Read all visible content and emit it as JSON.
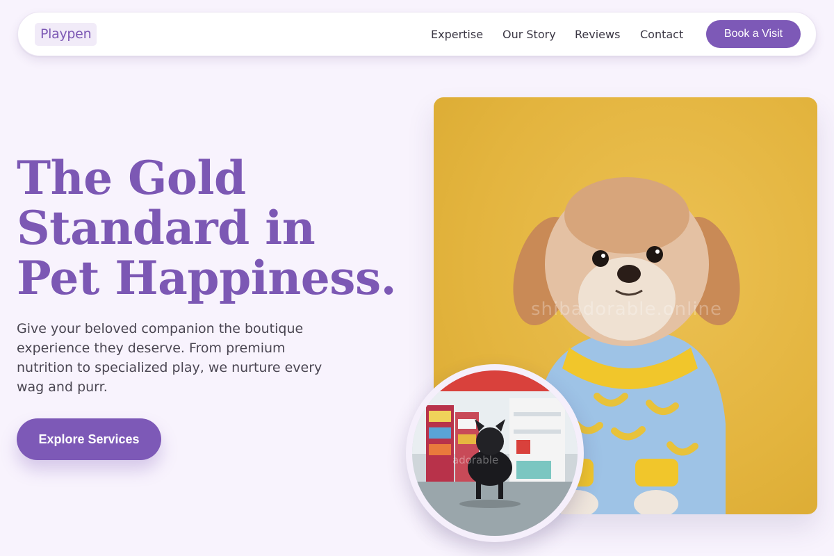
{
  "nav": {
    "logo": "Playpen",
    "links": [
      "Expertise",
      "Our Story",
      "Reviews",
      "Contact"
    ],
    "cta": "Book a Visit"
  },
  "hero": {
    "headline_lines": [
      "The Gold",
      "Standard in",
      "Pet Happiness."
    ],
    "subcopy": "Give your beloved companion the boutique experience they deserve. From premium nutrition to specialized play, we nurture every wag and purr.",
    "cta": "Explore Services"
  },
  "images": {
    "main_watermark": "shibadorable.online",
    "circle_watermark": "adorable"
  },
  "colors": {
    "brand_purple": "#7d59b7",
    "background": "#f8f3fd",
    "photo_yellow": "#e3b43e"
  }
}
